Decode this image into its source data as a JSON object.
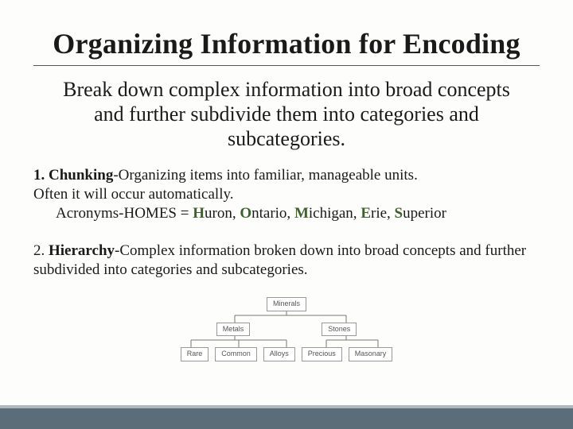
{
  "title": "Organizing Information for Encoding",
  "subtitle": "Break down complex information into broad concepts and further subdivide them into categories and subcategories.",
  "item1": {
    "num": "1.",
    "term": "Chunking",
    "def": "-Organizing items into familiar, manageable units.",
    "line2": "Often it will occur automatically.",
    "acronym_label": "Acronyms-HOMES = ",
    "lakes": {
      "h": "H",
      "huron_rest": "uron, ",
      "o": "O",
      "ontario_rest": "ntario, ",
      "m": "M",
      "michigan_rest": "ichigan, ",
      "e": "E",
      "erie_rest": "rie, ",
      "s": "S",
      "superior_rest": "uperior"
    }
  },
  "item2": {
    "num": "2.",
    "term": "Hierarchy",
    "def": "-Complex information broken down into broad concepts and further subdivided into categories and subcategories."
  },
  "diagram": {
    "root": "Minerals",
    "mid": [
      "Metals",
      "Stones"
    ],
    "leaves": [
      "Rare",
      "Common",
      "Alloys",
      "Precious",
      "Masonary"
    ]
  }
}
